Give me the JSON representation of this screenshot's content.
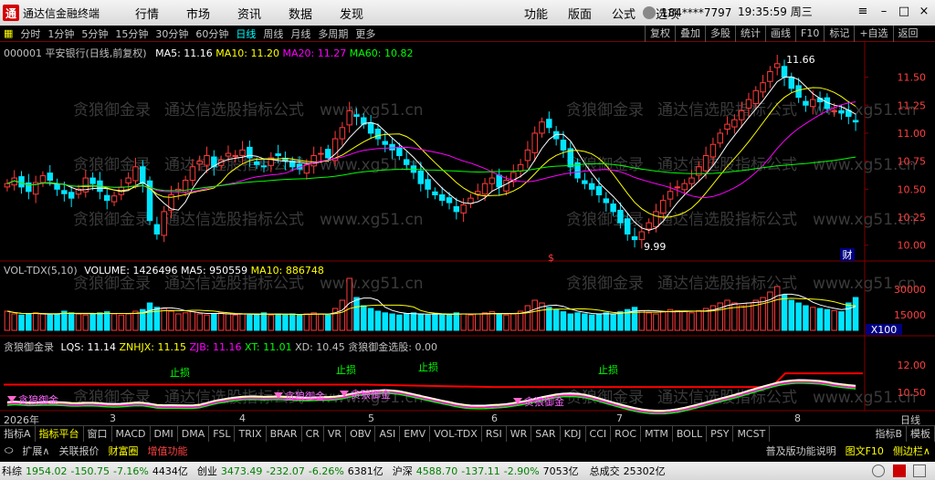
{
  "window": {
    "title": "通达信金融终端",
    "user": "184****7797",
    "clock": "19:35:59 周三"
  },
  "menu": [
    "行情",
    "市场",
    "资讯",
    "数据",
    "发现",
    "功能",
    "版面",
    "公式",
    "选项"
  ],
  "toolbar": {
    "periods": [
      "分时",
      "1分钟",
      "5分钟",
      "15分钟",
      "30分钟",
      "60分钟",
      "日线",
      "周线",
      "月线",
      "多周期",
      "更多"
    ],
    "active_period": "日线",
    "right_buttons": [
      "复权",
      "叠加",
      "多股",
      "统计",
      "画线",
      "F10",
      "标记",
      "+自选",
      "返回"
    ]
  },
  "price_header": {
    "stock": "000001 平安银行(日线,前复权)",
    "ma5": "MA5: 11.16",
    "ma10": "MA10: 11.20",
    "ma20": "MA20: 11.27",
    "ma60": "MA60: 10.82"
  },
  "vol_header": {
    "name": "VOL-TDX(5,10)",
    "volume": "VOLUME: 1426496",
    "ma5": "MA5: 950559",
    "ma10": "MA10: 886748"
  },
  "ind_header": {
    "name": "贪狼御金录",
    "lqs": "LQS: 11.14",
    "znhjx": "ZNHJX: 11.15",
    "zjb": "ZJB: 11.16",
    "xt": "XT: 11.01",
    "xd": "XD: 10.45",
    "xg": "贪狼御金选股: 0.00"
  },
  "price_axis": [
    "11.50",
    "11.25",
    "11.00",
    "10.75",
    "10.50",
    "10.25",
    "10.00"
  ],
  "vol_axis": [
    "30000",
    "15000"
  ],
  "vol_unit": "X100",
  "ind_axis": [
    "12.00",
    "10.50"
  ],
  "annotations": {
    "high": "11.66",
    "low": "9.99",
    "stop_loss": [
      "止损",
      "止损",
      "止损",
      "止损"
    ],
    "buy_labels": [
      "贪狼御金",
      "贪狼御金",
      "贪狼御金",
      "贪狼御金"
    ],
    "cai": "财",
    "s_marker": "$"
  },
  "watermark": [
    "贪狼御金录",
    "通达信选股指标公式",
    "www.xg51.cn"
  ],
  "date_axis": [
    "2026年",
    "3",
    "4",
    "5",
    "6",
    "7",
    "8"
  ],
  "daily_label": "日线",
  "indicator_tabs": [
    "指标A",
    "指标平台",
    "窗口",
    "MACD",
    "DMI",
    "DMA",
    "FSL",
    "TRIX",
    "BRAR",
    "CR",
    "VR",
    "OBV",
    "ASI",
    "EMV",
    "VOL-TDX",
    "RSI",
    "WR",
    "SAR",
    "KDJ",
    "CCI",
    "ROC",
    "MTM",
    "BOLL",
    "PSY",
    "MCST"
  ],
  "active_indicator_tab": "指标平台",
  "tab_right": [
    "指标B",
    "模板"
  ],
  "ext_row": {
    "expand": "扩展∧",
    "linked": "关联报价",
    "wealth": "财富圈",
    "add": "增值功能",
    "ext_func": "普及版功能说明",
    "f10": "图文F10",
    "sidebar": "侧边栏∧"
  },
  "status": [
    {
      "name": "科综",
      "value": "1954.02",
      "change": "-150.75",
      "pct": "-7.16%",
      "amount": "4434亿"
    },
    {
      "name": "创业",
      "value": "3473.49",
      "change": "-232.07",
      "pct": "-6.26%",
      "amount": "6381亿"
    },
    {
      "name": "沪深",
      "value": "4588.70",
      "change": "-137.11",
      "pct": "-2.90%",
      "amount": "7053亿"
    }
  ],
  "status_total_label": "总成交",
  "status_total": "25302亿",
  "colors": {
    "up": "#ff3b3b",
    "down": "#00e5ff",
    "ma5": "#ffffff",
    "ma10": "#ffff00",
    "ma20": "#ff00ff",
    "ma60": "#00ff00"
  },
  "chart_data": {
    "type": "candlestick",
    "ylim": [
      9.9,
      11.7
    ],
    "closes": [
      10.55,
      10.6,
      10.52,
      10.48,
      10.56,
      10.62,
      10.58,
      10.5,
      10.46,
      10.42,
      10.5,
      10.6,
      10.55,
      10.48,
      10.4,
      10.44,
      10.52,
      10.6,
      10.7,
      10.55,
      10.22,
      10.1,
      10.3,
      10.45,
      10.5,
      10.58,
      10.7,
      10.75,
      10.8,
      10.7,
      10.76,
      10.82,
      10.8,
      10.85,
      10.78,
      10.72,
      10.7,
      10.78,
      10.8,
      10.75,
      10.7,
      10.68,
      10.72,
      10.8,
      10.82,
      10.78,
      10.95,
      11.05,
      11.2,
      11.15,
      11.08,
      11.0,
      10.95,
      10.9,
      10.85,
      10.8,
      10.72,
      10.65,
      10.55,
      10.5,
      10.45,
      10.4,
      10.38,
      10.3,
      10.36,
      10.42,
      10.48,
      10.55,
      10.6,
      10.52,
      10.58,
      10.65,
      10.72,
      10.85,
      11.0,
      11.1,
      11.05,
      10.95,
      10.85,
      10.7,
      10.6,
      10.55,
      10.5,
      10.45,
      10.38,
      10.3,
      10.2,
      10.1,
      10.05,
      10.12,
      10.2,
      10.3,
      10.4,
      10.48,
      10.52,
      10.55,
      10.6,
      10.7,
      10.8,
      10.9,
      11.0,
      11.08,
      11.12,
      11.2,
      11.3,
      11.38,
      11.45,
      11.55,
      11.62,
      11.5,
      11.4,
      11.32,
      11.25,
      11.3,
      11.28,
      11.22,
      11.2,
      11.18,
      11.15,
      11.1
    ],
    "volumes": [
      0.35,
      0.3,
      0.28,
      0.3,
      0.32,
      0.3,
      0.28,
      0.3,
      0.35,
      0.32,
      0.3,
      0.28,
      0.3,
      0.32,
      0.34,
      0.3,
      0.28,
      0.3,
      0.35,
      0.38,
      0.5,
      0.42,
      0.4,
      0.35,
      0.3,
      0.32,
      0.34,
      0.3,
      0.28,
      0.3,
      0.32,
      0.3,
      0.28,
      0.3,
      0.28,
      0.3,
      0.32,
      0.28,
      0.3,
      0.28,
      0.3,
      0.28,
      0.3,
      0.32,
      0.3,
      0.28,
      0.4,
      0.55,
      0.95,
      0.6,
      0.45,
      0.4,
      0.35,
      0.32,
      0.3,
      0.28,
      0.3,
      0.32,
      0.3,
      0.28,
      0.3,
      0.28,
      0.3,
      0.32,
      0.3,
      0.28,
      0.3,
      0.32,
      0.34,
      0.3,
      0.28,
      0.3,
      0.35,
      0.45,
      0.55,
      0.5,
      0.42,
      0.38,
      0.34,
      0.3,
      0.32,
      0.3,
      0.28,
      0.3,
      0.32,
      0.3,
      0.34,
      0.38,
      0.42,
      0.36,
      0.32,
      0.3,
      0.34,
      0.38,
      0.36,
      0.34,
      0.32,
      0.36,
      0.4,
      0.45,
      0.5,
      0.55,
      0.5,
      0.45,
      0.5,
      0.55,
      0.6,
      0.7,
      0.8,
      0.65,
      0.55,
      0.5,
      0.45,
      0.42,
      0.4,
      0.38,
      0.36,
      0.34,
      0.5,
      0.6
    ]
  }
}
